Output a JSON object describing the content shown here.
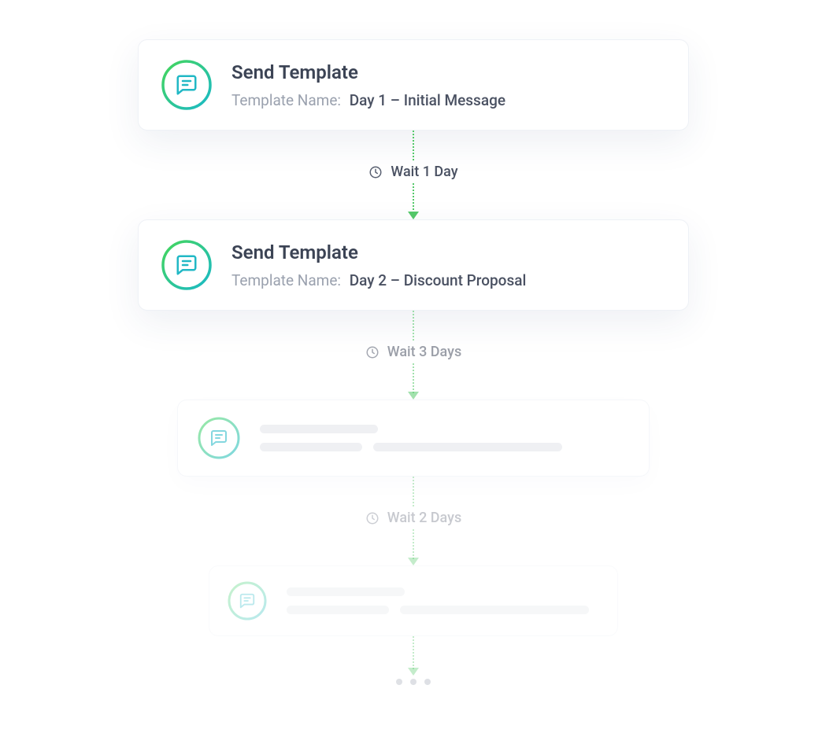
{
  "flow": {
    "steps": [
      {
        "title": "Send Template",
        "sub_label": "Template Name:",
        "sub_value": "Day 1 – Initial Message"
      },
      {
        "title": "Send Template",
        "sub_label": "Template Name:",
        "sub_value": "Day 2 – Discount Proposal"
      }
    ],
    "waits": [
      {
        "label": "Wait 1 Day"
      },
      {
        "label": "Wait 3 Days"
      },
      {
        "label": "Wait 2 Days"
      }
    ]
  }
}
